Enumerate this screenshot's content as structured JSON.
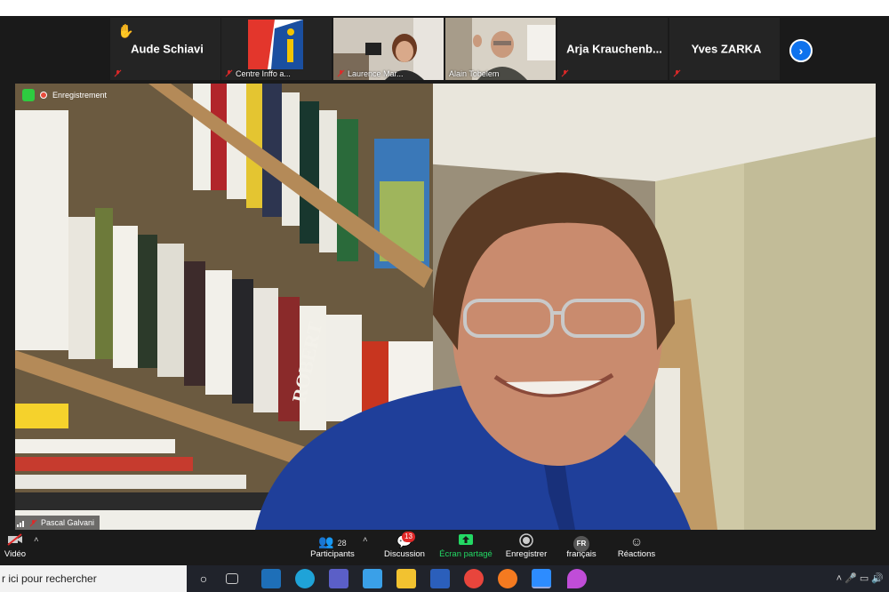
{
  "participants_strip": [
    {
      "name": "Aude Schiavi",
      "label": "",
      "raised_hand": true,
      "muted": true
    },
    {
      "name": "",
      "label": "Centre Inffo a...",
      "muted": true
    },
    {
      "name": "",
      "label": "Laurence Mar...",
      "muted": true
    },
    {
      "name": "",
      "label": "Alain Tobelem",
      "muted": false
    },
    {
      "name": "Arja  Krauchenb...",
      "label": "",
      "muted": true
    },
    {
      "name": "Yves ZARKA",
      "label": "",
      "muted": true
    }
  ],
  "next_icon": "chevron-right-icon",
  "main_video": {
    "recording_label": "Enregistrement",
    "speaker_name": "Pascal Galvani",
    "book_spine_text": "ROBERT"
  },
  "toolbar": {
    "video_label": "Vidéo",
    "participants_label": "Participants",
    "participants_count": "28",
    "chat_label": "Discussion",
    "chat_badge": "13",
    "share_label": "Écran partagé",
    "record_label": "Enregistrer",
    "language_code": "FR",
    "language_label": "français",
    "reactions_label": "Réactions"
  },
  "taskbar": {
    "search_text": "r ici pour rechercher"
  },
  "colors": {
    "zoom_bg": "#1a1a1a",
    "share_green": "#23d964",
    "zoom_blue": "#0e72ed",
    "badge_red": "#e02828"
  }
}
